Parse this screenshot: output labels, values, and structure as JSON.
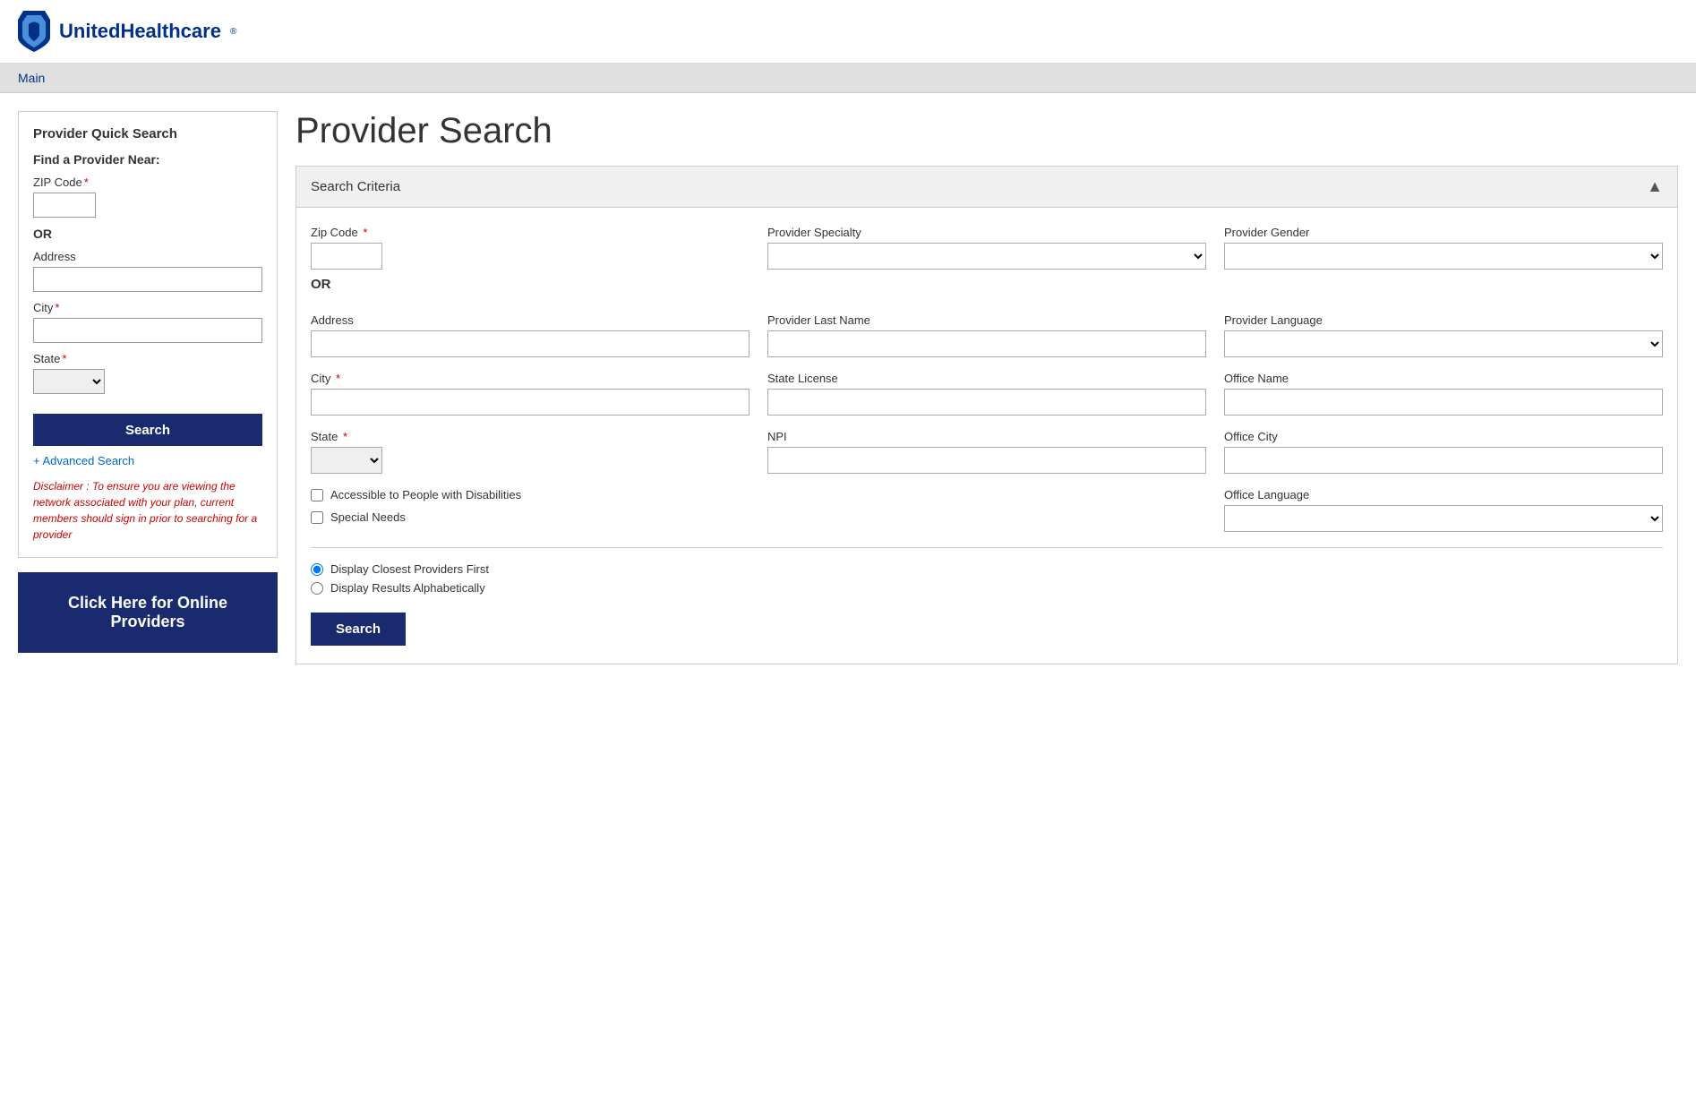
{
  "header": {
    "logo_text": "UnitedHealthcare",
    "logo_aria": "UnitedHealthcare logo"
  },
  "nav": {
    "main_label": "Main"
  },
  "sidebar": {
    "title": "Provider Quick Search",
    "find_label": "Find a Provider Near:",
    "zip_label": "ZIP Code",
    "or_text": "OR",
    "address_label": "Address",
    "city_label": "City",
    "state_label": "State",
    "search_button": "Search",
    "advanced_link": "+ Advanced Search",
    "disclaimer": "Disclaimer : To ensure you are viewing the network associated with your plan, current members should sign in prior to searching for a provider",
    "online_button": "Click Here for Online Providers"
  },
  "main": {
    "page_title": "Provider Search",
    "panel_title": "Search Criteria",
    "fields": {
      "zip_label": "Zip Code",
      "or_text": "OR",
      "address_label": "Address",
      "city_label": "City",
      "state_label": "State",
      "provider_specialty_label": "Provider Specialty",
      "provider_last_name_label": "Provider Last Name",
      "state_license_label": "State License",
      "npi_label": "NPI",
      "provider_gender_label": "Provider Gender",
      "provider_language_label": "Provider Language",
      "office_name_label": "Office Name",
      "office_city_label": "Office City",
      "office_language_label": "Office Language",
      "accessible_label": "Accessible to People with Disabilities",
      "special_needs_label": "Special Needs"
    },
    "radio": {
      "closest_label": "Display Closest Providers First",
      "alphabetical_label": "Display Results Alphabetically"
    },
    "search_button": "Search"
  }
}
